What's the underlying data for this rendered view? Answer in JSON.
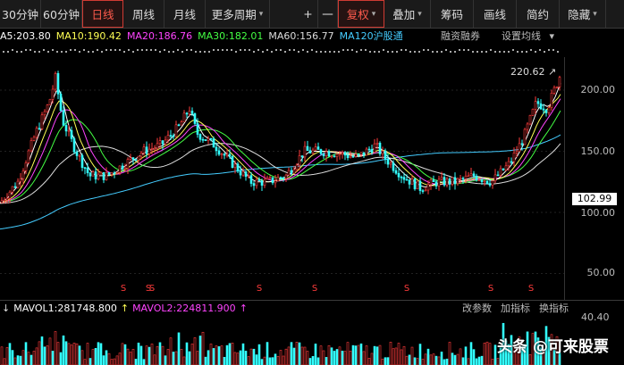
{
  "toolbar": {
    "items": [
      {
        "label": "30分钟"
      },
      {
        "label": "60分钟"
      },
      {
        "label": "日线"
      },
      {
        "label": "周线"
      },
      {
        "label": "月线"
      },
      {
        "label": "更多周期"
      },
      {
        "label": "+"
      },
      {
        "label": "一"
      },
      {
        "label": "复权"
      },
      {
        "label": "叠加"
      },
      {
        "label": "筹码"
      },
      {
        "label": "画线"
      },
      {
        "label": "简约"
      },
      {
        "label": "隐藏"
      }
    ],
    "active": "日线",
    "colors": {
      "active": "#ff5b4d"
    }
  },
  "ma_legend": {
    "items": [
      {
        "text": "A5:203.80",
        "color": "#ffffff"
      },
      {
        "text": "MA10:190.42",
        "color": "#ffff55"
      },
      {
        "text": "MA20:186.76",
        "color": "#ff44ff"
      },
      {
        "text": "MA30:182.01",
        "color": "#44ff44"
      },
      {
        "text": "MA60:156.77",
        "color": "#dddddd"
      },
      {
        "text": "MA120沪股通",
        "color": "#44ccff"
      }
    ],
    "links": [
      "融资融券",
      "设置均线"
    ]
  },
  "price_axis": {
    "ticks": [
      "200.00",
      "150.00",
      "100.00",
      "50.00"
    ],
    "current": "102.99",
    "peak": "220.62"
  },
  "vol_legend": {
    "items": [
      {
        "text": "MAVOL1:281748.800",
        "color": "#ffffff"
      },
      {
        "text": "MAVOL2:224811.900",
        "color": "#ff44ff"
      }
    ],
    "links": [
      "改参数",
      "加指标",
      "换指标"
    ],
    "axis": "40.40"
  },
  "watermark": "头条 @可来股票",
  "markers": {
    "symbol": "S",
    "count": 8
  },
  "colors": {
    "up": "#ff3b3b",
    "down": "#33ffff",
    "background": "#000000",
    "ma5": "#ffffff",
    "ma10": "#ffff55",
    "ma20": "#ff44ff",
    "ma30": "#44ff44",
    "ma60": "#dddddd",
    "ma120": "#44ccff"
  }
}
